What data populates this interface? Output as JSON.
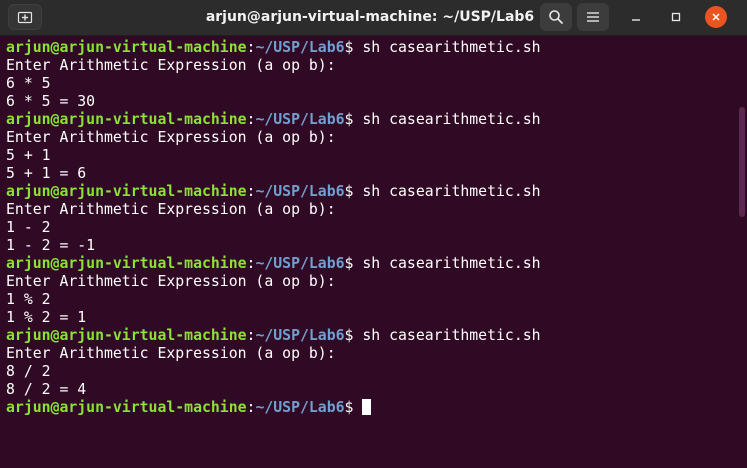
{
  "window": {
    "title": "arjun@arjun-virtual-machine: ~/USP/Lab6"
  },
  "icons": {
    "new_tab": "new-tab-icon",
    "search": "search-icon",
    "menu": "hamburger-menu-icon",
    "minimize": "minimize-icon",
    "maximize": "maximize-icon",
    "close": "close-icon"
  },
  "colors": {
    "background": "#300a24",
    "prompt_user": "#8ae234",
    "prompt_path": "#729fcf",
    "close_button": "#e95420"
  },
  "terminal": {
    "prompt": {
      "user": "arjun@arjun-virtual-machine",
      "sep": ":",
      "path": "~/USP/Lab6",
      "symbol": "$ "
    },
    "lines": [
      {
        "cmd": "sh casearithmetic.sh"
      },
      {
        "text": "Enter Arithmetic Expression (a op b):"
      },
      {
        "text": "6 * 5"
      },
      {
        "text": "6 * 5 = 30"
      },
      {
        "cmd": "sh casearithmetic.sh"
      },
      {
        "text": "Enter Arithmetic Expression (a op b):"
      },
      {
        "text": "5 + 1"
      },
      {
        "text": "5 + 1 = 6"
      },
      {
        "cmd": "sh casearithmetic.sh"
      },
      {
        "text": "Enter Arithmetic Expression (a op b):"
      },
      {
        "text": "1 - 2"
      },
      {
        "text": "1 - 2 = -1"
      },
      {
        "cmd": "sh casearithmetic.sh"
      },
      {
        "text": "Enter Arithmetic Expression (a op b):"
      },
      {
        "text": "1 % 2"
      },
      {
        "text": "1 % 2 = 1"
      },
      {
        "cmd": "sh casearithmetic.sh"
      },
      {
        "text": "Enter Arithmetic Expression (a op b):"
      },
      {
        "text": "8 / 2"
      },
      {
        "text": "8 / 2 = 4"
      },
      {
        "cmd": ""
      }
    ]
  }
}
